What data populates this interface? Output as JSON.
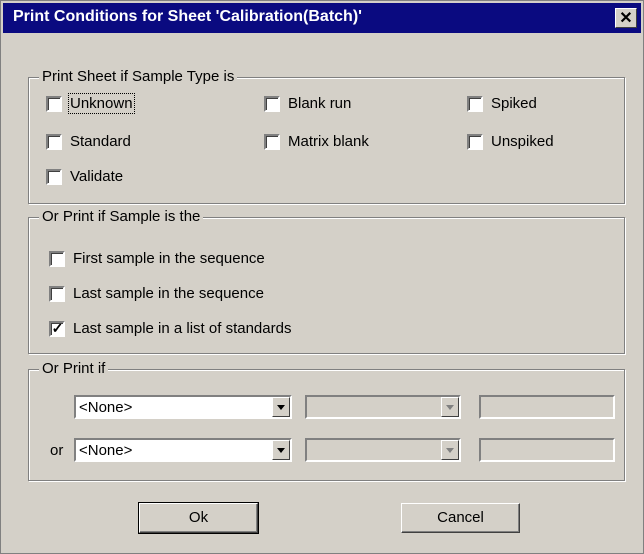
{
  "window": {
    "title": "Print Conditions for Sheet 'Calibration(Batch)'",
    "close_glyph": "✕"
  },
  "sample_type": {
    "legend": "Print Sheet if Sample Type is",
    "options": [
      {
        "label": "Unknown",
        "checked": false
      },
      {
        "label": "Blank run",
        "checked": false
      },
      {
        "label": "Spiked",
        "checked": false
      },
      {
        "label": "Standard",
        "checked": false
      },
      {
        "label": "Matrix blank",
        "checked": false
      },
      {
        "label": "Unspiked",
        "checked": false
      },
      {
        "label": "Validate",
        "checked": false
      }
    ]
  },
  "sample_position": {
    "legend": "Or Print if Sample is the",
    "options": [
      {
        "label": "First sample in the sequence",
        "checked": false
      },
      {
        "label": "Last sample in the sequence",
        "checked": false
      },
      {
        "label": "Last sample in a list of standards",
        "checked": true,
        "mark": "✓"
      }
    ]
  },
  "conditions": {
    "legend": "Or Print if",
    "or_label": "or",
    "rows": [
      {
        "field": "<None>",
        "operator": "",
        "value": ""
      },
      {
        "field": "<None>",
        "operator": "",
        "value": ""
      }
    ]
  },
  "buttons": {
    "ok": "Ok",
    "cancel": "Cancel"
  },
  "icons": {
    "dropdown": "chevron-down-icon",
    "close": "close-icon",
    "check": "checkmark-icon"
  }
}
